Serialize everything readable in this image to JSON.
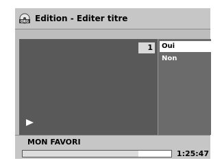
{
  "header": {
    "title": "Edition - Editer titre",
    "icon": "disc-original-icon"
  },
  "preview": {
    "title_number": "1",
    "status_icon": "play-icon"
  },
  "menu": {
    "options": [
      "Oui",
      "Non"
    ],
    "selected": "Oui"
  },
  "title_name": "MON FAVORI",
  "progress": {
    "fraction": 0.78,
    "time": "1:25:47"
  }
}
